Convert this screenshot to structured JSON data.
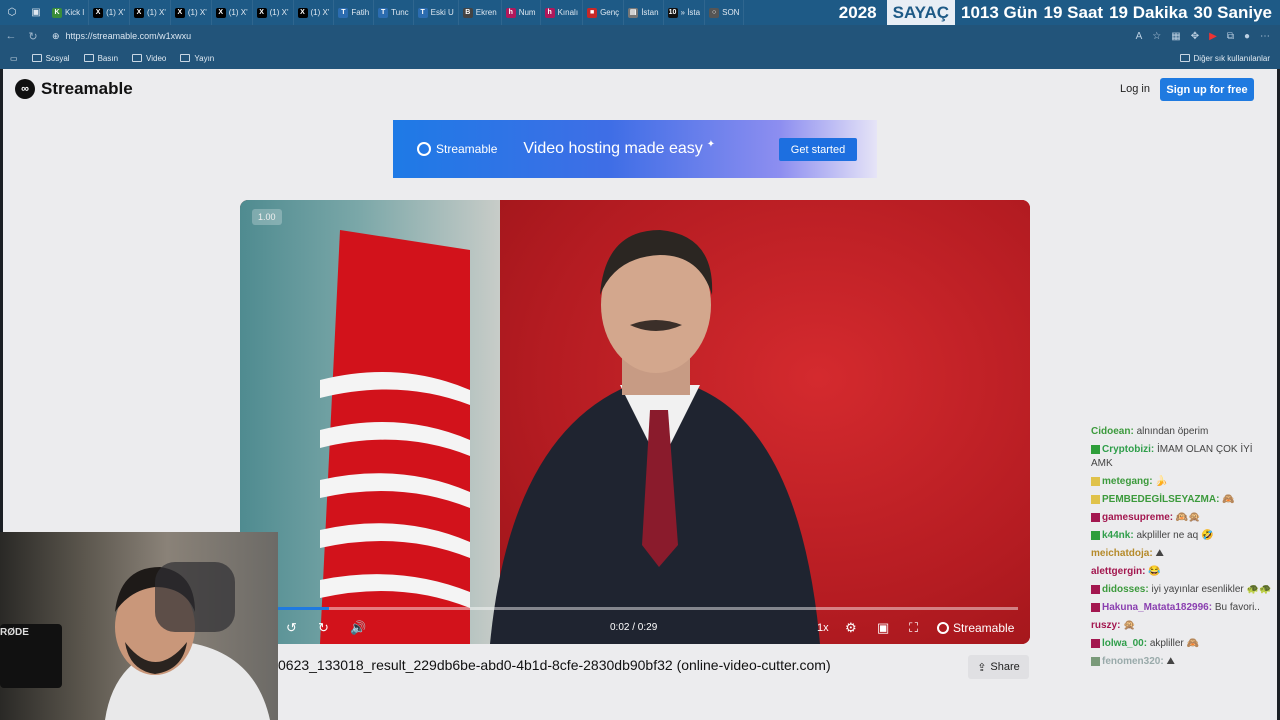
{
  "tabs": [
    {
      "label": "Kick l",
      "color": "#3a8d3a",
      "glyph": "K"
    },
    {
      "label": "(1) X'",
      "color": "#000000",
      "glyph": "X"
    },
    {
      "label": "(1) X'",
      "color": "#000000",
      "glyph": "X"
    },
    {
      "label": "(1) X'",
      "color": "#000000",
      "glyph": "X"
    },
    {
      "label": "(1) X'",
      "color": "#000000",
      "glyph": "X"
    },
    {
      "label": "(1) X'",
      "color": "#000000",
      "glyph": "X"
    },
    {
      "label": "(1) X'",
      "color": "#000000",
      "glyph": "X"
    },
    {
      "label": "Fatih",
      "color": "#2b6cb0",
      "glyph": "T"
    },
    {
      "label": "Tunc",
      "color": "#2b6cb0",
      "glyph": "T"
    },
    {
      "label": "Eski U",
      "color": "#2b6cb0",
      "glyph": "T"
    },
    {
      "label": "Ekren",
      "color": "#444444",
      "glyph": "B"
    },
    {
      "label": "Num",
      "color": "#b0185b",
      "glyph": "h"
    },
    {
      "label": "Kınalı",
      "color": "#b0185b",
      "glyph": "h"
    },
    {
      "label": "Genç",
      "color": "#c62828",
      "glyph": "■"
    },
    {
      "label": "İstan",
      "color": "#777777",
      "glyph": "▤"
    },
    {
      "label": "» İsta",
      "color": "#111111",
      "glyph": "10"
    },
    {
      "label": "SON",
      "color": "#555555",
      "glyph": "○"
    }
  ],
  "counter": {
    "year": "2028",
    "label": "SAYAÇ",
    "days": "1013 Gün",
    "hours": "19 Saat",
    "minutes": "19 Dakika",
    "seconds": "30 Saniye"
  },
  "address": {
    "url": "https://streamable.com/w1xwxu"
  },
  "bookmarks": {
    "items": [
      "Sosyal",
      "Basın",
      "Video",
      "Yayın"
    ],
    "other": "Diğer sık kullanılanlar"
  },
  "site": {
    "logo": "Streamable",
    "login": "Log in",
    "signup": "Sign up for free",
    "banner": {
      "logo": "Streamable",
      "tagline": "Video hosting made easy",
      "cta": "Get started"
    },
    "player": {
      "speed_badge": "1.00",
      "time": "0:02 / 0:29",
      "rate": "1x",
      "brand": "Streamable",
      "progress_fraction": 0.069
    },
    "video_title": "0623_133018_result_229db6be-abd0-4b1d-8cfe-2830db90bf32 (online-video-cutter.com)",
    "share": "Share"
  },
  "chat": [
    {
      "user": "Cidoean:",
      "color": "#3c9a3c",
      "text": "alnından öperim",
      "badge": ""
    },
    {
      "user": "Cryptobizi:",
      "color": "#2f9e4a",
      "text": "İMAM OLAN ÇOK İYİ AMK",
      "badge": "#2e9e3a"
    },
    {
      "user": "metegang:",
      "color": "#3c9a3c",
      "text": "🍌",
      "badge": "#e0c24a"
    },
    {
      "user": "PEMBEDEGİLSEYAZMA:",
      "color": "#3c9a3c",
      "text": "🙈",
      "badge": "#e0c24a"
    },
    {
      "user": "gamesupreme:",
      "color": "#a3174f",
      "text": "🙉🙊",
      "badge": "#a3174f"
    },
    {
      "user": "k44nk:",
      "color": "#2f9e4a",
      "text": "akpliller ne aq 🤣",
      "badge": "#2e9e3a"
    },
    {
      "user": "meichatdoja:",
      "color": "#b58a2a",
      "text": "⛰",
      "badge": ""
    },
    {
      "user": "alettgergin:",
      "color": "#a3174f",
      "text": "😂",
      "badge": ""
    },
    {
      "user": "didosses:",
      "color": "#3c9a3c",
      "text": "iyi yayınlar esenlikler 🐢🐢",
      "badge": "#a3174f"
    },
    {
      "user": "Hakuna_Matata182996:",
      "color": "#8a3fb0",
      "text": "Bu favori..",
      "badge": "#a3174f"
    },
    {
      "user": "ruszy:",
      "color": "#a3174f",
      "text": "🙊",
      "badge": ""
    },
    {
      "user": "lolwa_00:",
      "color": "#2f9e4a",
      "text": "akpliller 🙈",
      "badge": "#a3174f"
    },
    {
      "user": "fenomen320:",
      "color": "#9aa",
      "text": "⛰",
      "badge": "#7a9a7a"
    }
  ],
  "webcam": {
    "mic_label": "RØDE"
  }
}
